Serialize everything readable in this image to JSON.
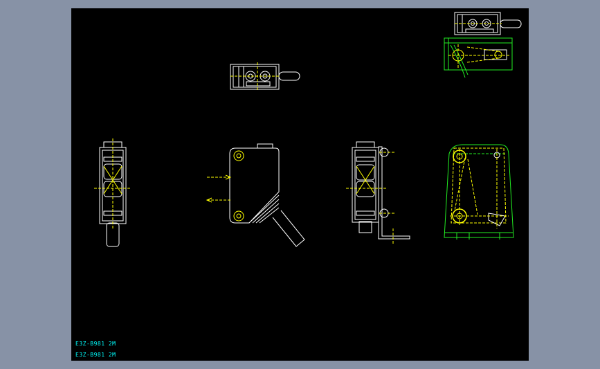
{
  "colors": {
    "viewport_bg": "#8792a6",
    "canvas_bg": "#000000",
    "outline": "#ffffff",
    "centerline": "#ffff00",
    "bracket": "#22ee22",
    "caption": "#00ffff"
  },
  "captions": [
    {
      "text": "E3Z-B981 2M"
    },
    {
      "text": "E3Z-B981 2M"
    }
  ],
  "views": [
    {
      "name": "top-view"
    },
    {
      "name": "corner-top-view"
    },
    {
      "name": "corner-bracket-side-view"
    },
    {
      "name": "front-view"
    },
    {
      "name": "side-view"
    },
    {
      "name": "front-view-with-bracket"
    },
    {
      "name": "bracket-side-view"
    }
  ]
}
